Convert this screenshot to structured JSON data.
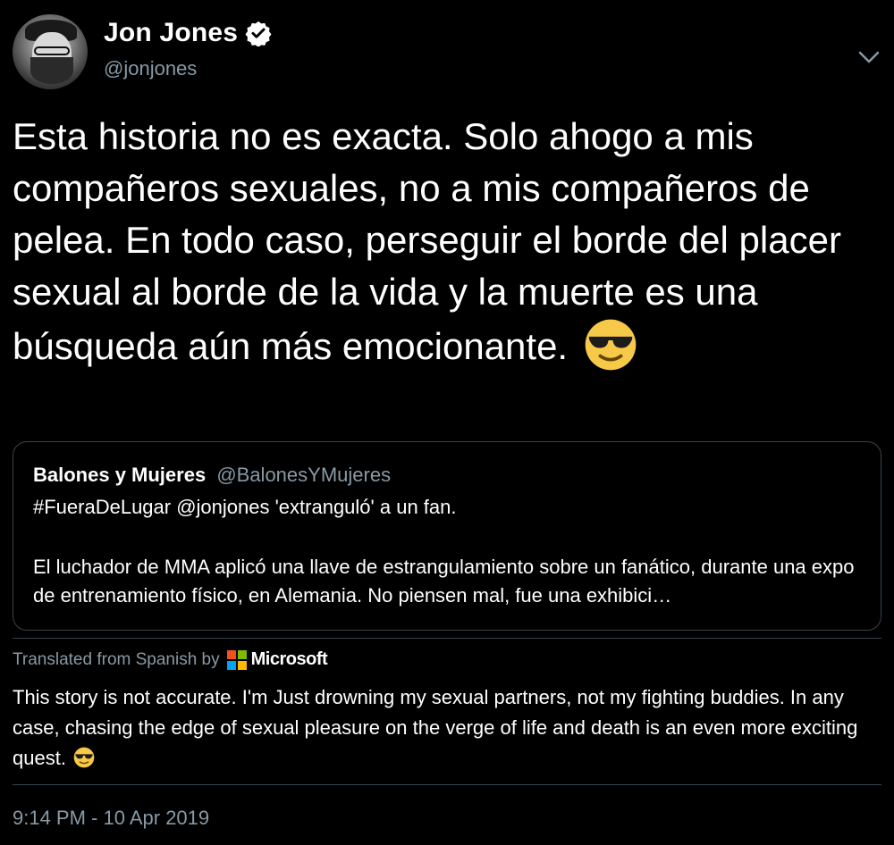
{
  "author": {
    "display_name": "Jon Jones",
    "handle": "@jonjones"
  },
  "tweet": {
    "text": "Esta historia no es exacta. Solo ahogo a mis compañeros sexuales, no a mis compañeros de pelea. En todo caso, perseguir el borde del placer sexual al borde de la vida y la muerte es una búsqueda aún más emocionante.",
    "emoji": "smiling-face-with-sunglasses"
  },
  "quoted_tweet": {
    "author_name": "Balones y Mujeres",
    "author_handle": "@BalonesYMujeres",
    "line1": "#FueraDeLugar @jonjones 'extranguló' a un fan.",
    "body": "El luchador de MMA aplicó una llave de estrangulamiento sobre un fanático, durante una expo de entrenamiento físico, en Alemania. No piensen mal, fue una exhibici…"
  },
  "translation": {
    "label": "Translated from Spanish by",
    "provider": "Microsoft",
    "text": "This story is not accurate. I'm Just drowning my sexual partners, not my fighting buddies. In any case, chasing the edge of sexual pleasure on the verge of life and death is an even more exciting quest."
  },
  "timestamp": "9:14 PM - 10 Apr 2019",
  "colors": {
    "background": "#000000",
    "text_primary": "#ffffff",
    "text_secondary": "#8899a6",
    "border": "#38444d",
    "emoji_yellow": "#f7c948",
    "ms_red": "#f25022",
    "ms_green": "#7fba00",
    "ms_blue": "#00a4ef",
    "ms_yellow": "#ffb900"
  },
  "icons": {
    "verified": "verified-badge-icon",
    "caret": "chevron-down-icon",
    "emoji": "sunglasses-emoji-icon",
    "microsoft": "microsoft-logo-icon"
  }
}
